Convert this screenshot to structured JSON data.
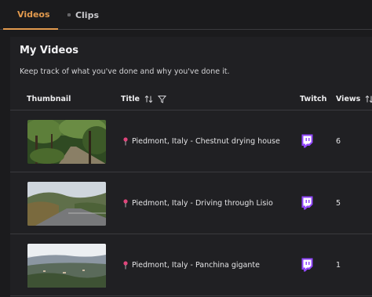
{
  "tabs": [
    {
      "label": "Videos",
      "icon": "video-camera-icon",
      "active": true
    },
    {
      "label": "Clips",
      "icon": "film-icon",
      "active": false
    }
  ],
  "colors": {
    "accent": "#e29a4e",
    "twitch": "#9146ff",
    "pin": "#e0457b"
  },
  "panel": {
    "title": "My Videos",
    "subtitle": "Keep track of what you've done and why you've done it."
  },
  "table": {
    "headers": {
      "thumbnail": "Thumbnail",
      "title": "Title",
      "twitch": "Twitch",
      "views": "Views"
    },
    "rows": [
      {
        "title": "Piedmont, Italy - Chestnut drying house",
        "views": "6",
        "thumb": "forest-road"
      },
      {
        "title": "Piedmont, Italy - Driving through Lisio",
        "views": "5",
        "thumb": "mountain-road"
      },
      {
        "title": "Piedmont, Italy - Panchina gigante",
        "views": "1",
        "thumb": "valley-view"
      }
    ]
  }
}
